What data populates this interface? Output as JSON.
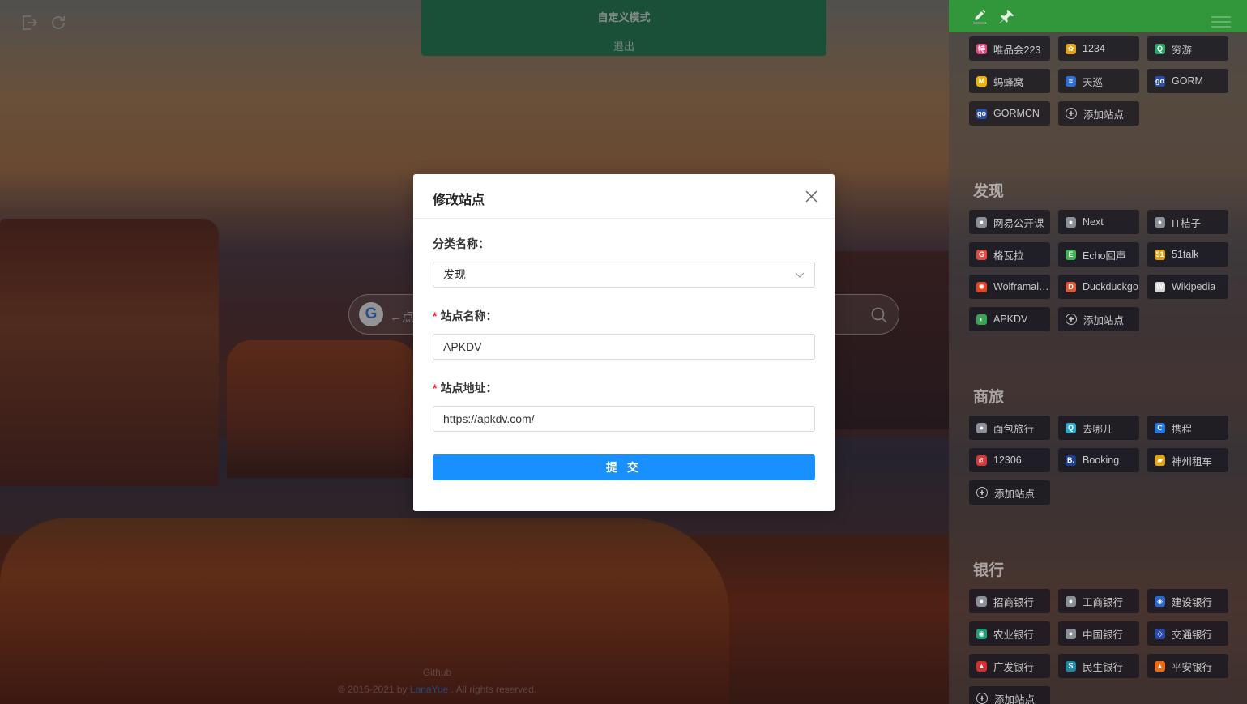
{
  "mode_panel": {
    "title": "自定义模式",
    "exit_label": "退出"
  },
  "search": {
    "placeholder": "←点",
    "engine": "G"
  },
  "footer": {
    "github": "Github",
    "copyright_prefix": "© 2016-2021 by ",
    "author": "LanaYue",
    "copyright_suffix": " . All rights reserved."
  },
  "dialog": {
    "title": "修改站点",
    "category_label": "分类名称：",
    "category_value": "发现",
    "site_name_label": "站点名称：",
    "site_name_value": "APKDV",
    "site_url_label": "站点地址：",
    "site_url_value": "https://apkdv.com/",
    "submit_label": "提 交",
    "required_mark": "*"
  },
  "sidebar": {
    "accent": "#32973a",
    "groups": [
      {
        "title": "",
        "sites": [
          {
            "label": "唯品会223",
            "icon": "vip-icon",
            "color": "#e6457a",
            "glyph": "特"
          },
          {
            "label": "1234",
            "icon": "gear-flower-icon",
            "color": "#e5a11a",
            "glyph": "✿"
          },
          {
            "label": "穷游",
            "icon": "qyer-icon",
            "color": "#2fa36b",
            "glyph": "Q"
          },
          {
            "label": "蚂蜂窝",
            "icon": "mafengwo-icon",
            "color": "#f0b400",
            "glyph": "M"
          },
          {
            "label": "天巡",
            "icon": "skyscanner-icon",
            "color": "#2f6fd6",
            "glyph": "≈"
          },
          {
            "label": "GORM",
            "icon": "gorm-icon",
            "color": "#2a4fa8",
            "glyph": "go"
          },
          {
            "label": "GORMCN",
            "icon": "gorm-icon",
            "color": "#2a4fa8",
            "glyph": "go"
          },
          {
            "label": "添加站点",
            "icon": "plus-circle-icon",
            "add": true
          }
        ]
      },
      {
        "title": "发现",
        "sites": [
          {
            "label": "网易公开课",
            "icon": "globe-icon",
            "color": "#8a8f98",
            "glyph": "●"
          },
          {
            "label": "Next",
            "icon": "globe-icon",
            "color": "#8a8f98",
            "glyph": "●"
          },
          {
            "label": "IT桔子",
            "icon": "globe-icon",
            "color": "#8a8f98",
            "glyph": "●"
          },
          {
            "label": "格瓦拉",
            "icon": "gewara-icon",
            "color": "#e24b3b",
            "glyph": "G"
          },
          {
            "label": "Echo回声",
            "icon": "echo-icon",
            "color": "#3fb34f",
            "glyph": "E"
          },
          {
            "label": "51talk",
            "icon": "51talk-icon",
            "color": "#e2a010",
            "glyph": "51"
          },
          {
            "label": "Wolframalpha",
            "icon": "wolfram-icon",
            "color": "#e2461f",
            "glyph": "✺"
          },
          {
            "label": "Duckduckgo",
            "icon": "duckduckgo-icon",
            "color": "#de5833",
            "glyph": "D"
          },
          {
            "label": "Wikipedia",
            "icon": "wikipedia-icon",
            "color": "#d8d8d8",
            "glyph": "W"
          },
          {
            "label": "APKDV",
            "icon": "apkdv-icon",
            "color": "#3aa655",
            "glyph": "◐"
          },
          {
            "label": "添加站点",
            "icon": "plus-circle-icon",
            "add": true
          }
        ]
      },
      {
        "title": "商旅",
        "sites": [
          {
            "label": "面包旅行",
            "icon": "globe-icon",
            "color": "#8a8f98",
            "glyph": "●"
          },
          {
            "label": "去哪儿",
            "icon": "qunar-icon",
            "color": "#2aa9c8",
            "glyph": "Q"
          },
          {
            "label": "携程",
            "icon": "ctrip-icon",
            "color": "#2577e3",
            "glyph": "C"
          },
          {
            "label": "12306",
            "icon": "12306-icon",
            "color": "#d33b3b",
            "glyph": "◎"
          },
          {
            "label": "Booking",
            "icon": "booking-icon",
            "color": "#1d3f8f",
            "glyph": "B."
          },
          {
            "label": "神州租车",
            "icon": "car-icon",
            "color": "#e3a316",
            "glyph": "▰"
          },
          {
            "label": "添加站点",
            "icon": "plus-circle-icon",
            "add": true
          }
        ]
      },
      {
        "title": "银行",
        "sites": [
          {
            "label": "招商银行",
            "icon": "globe-icon",
            "color": "#8a8f98",
            "glyph": "●"
          },
          {
            "label": "工商银行",
            "icon": "globe-icon",
            "color": "#8a8f98",
            "glyph": "●"
          },
          {
            "label": "建设银行",
            "icon": "ccb-icon",
            "color": "#2d68c4",
            "glyph": "◈"
          },
          {
            "label": "农业银行",
            "icon": "abc-icon",
            "color": "#1c9e7a",
            "glyph": "◉"
          },
          {
            "label": "中国银行",
            "icon": "globe-icon",
            "color": "#8a8f98",
            "glyph": "●"
          },
          {
            "label": "交通银行",
            "icon": "bocom-icon",
            "color": "#2b4aa6",
            "glyph": "◇"
          },
          {
            "label": "广发银行",
            "icon": "cgb-icon",
            "color": "#d62d2d",
            "glyph": "▲"
          },
          {
            "label": "民生银行",
            "icon": "cmbc-icon",
            "color": "#1c8aa8",
            "glyph": "S"
          },
          {
            "label": "平安银行",
            "icon": "pingan-icon",
            "color": "#f06a12",
            "glyph": "▲"
          },
          {
            "label": "添加站点",
            "icon": "plus-circle-icon",
            "add": true
          }
        ]
      }
    ]
  }
}
